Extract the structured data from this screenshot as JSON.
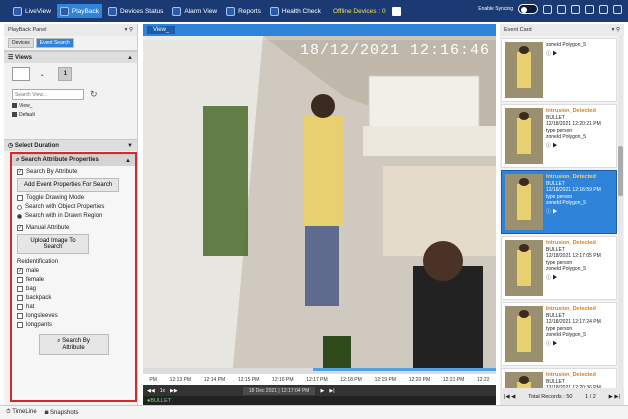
{
  "topbar": {
    "items": [
      {
        "label": "LiveView",
        "icon": "monitor-icon"
      },
      {
        "label": "PlayBack",
        "icon": "playback-icon"
      },
      {
        "label": "Devices Status",
        "icon": "devices-icon"
      },
      {
        "label": "Alarm View",
        "icon": "alarm-icon"
      },
      {
        "label": "Reports",
        "icon": "reports-icon"
      },
      {
        "label": "Health Check",
        "icon": "health-icon"
      }
    ],
    "offline": "Offline Devices : 0",
    "sync_label": "Enable Syncing"
  },
  "left_panel": {
    "title": "PlayBack Panel",
    "tabs": [
      "Devices",
      "Event Search"
    ],
    "views_title": "Views",
    "view_number": "1",
    "search_placeholder": "Search View...",
    "view_items": [
      "View_",
      "Default"
    ],
    "select_duration": "Select Duration",
    "attr_title": "Search Attribute Properties",
    "search_by_attribute": "Search By Attribute",
    "add_event_btn": "Add Event Properties For Search",
    "toggle_drawing": "Toggle Drawing Mode",
    "search_object": "Search with Object Properties",
    "search_drawn": "Search with in Drawn Region",
    "manual_attribute": "Manual Attribute",
    "upload_btn": "Upload Image To Search",
    "reid_label": "Reidentification",
    "reid_options": [
      {
        "label": "male",
        "checked": true
      },
      {
        "label": "female",
        "checked": false
      },
      {
        "label": "bag",
        "checked": false
      },
      {
        "label": "backpack",
        "checked": false
      },
      {
        "label": "hat",
        "checked": false
      },
      {
        "label": "longsleeves",
        "checked": false
      },
      {
        "label": "longpants",
        "checked": false
      }
    ],
    "search_btn": "Search By Attribute"
  },
  "video": {
    "tab": "View_",
    "timestamp": "18/12/2021 12:16:46",
    "ticks": [
      "PM",
      "12:13 PM",
      "12:14 PM",
      "12:15 PM",
      "12:16 PM",
      "12:17 PM",
      "12:18 PM",
      "12:19 PM",
      "12:20 PM",
      "12:21 PM",
      "12:22"
    ],
    "date": "18 Dec 2021 | 12:17:04 PM",
    "speed": "1x",
    "camera": "BULLET"
  },
  "right_panel": {
    "title": "Event Card",
    "cards": [
      {
        "title": "",
        "cam": "",
        "time": "",
        "type": "",
        "zone": "zoneId  Polygon_5",
        "selected": false
      },
      {
        "title": "Intrusion_Detected",
        "cam": "BULLET",
        "time": "12/18/2021 12:20:21 PM",
        "type": "type   person",
        "zone": "zoneId  Polygon_5",
        "selected": false
      },
      {
        "title": "Intrusion_Detected",
        "cam": "BULLET",
        "time": "12/18/2021 12:16:59 PM",
        "type": "type   person",
        "zone": "zoneId  Polygon_5",
        "selected": true
      },
      {
        "title": "Intrusion_Detected",
        "cam": "BULLET",
        "time": "12/18/2021 12:17:05 PM",
        "type": "type   person",
        "zone": "zoneId  Polygon_5",
        "selected": false
      },
      {
        "title": "Intrusion_Detected",
        "cam": "BULLET",
        "time": "12/18/2021 12:17:24 PM",
        "type": "type   person",
        "zone": "zoneId  Polygon_5",
        "selected": false
      },
      {
        "title": "Intrusion_Detected",
        "cam": "BULLET",
        "time": "12/18/2021 12:20:36 PM",
        "type": "type   person",
        "zone": "zoneId  Polygon_5",
        "selected": false
      }
    ],
    "total": "Total Records : 50",
    "page": "1 / 2"
  },
  "bottom": {
    "timeline": "TimeLine",
    "snapshots": "Snapshots"
  },
  "colors": {
    "topbar": "#1b3a74",
    "accent": "#2f83d9",
    "alert": "#e57a1a",
    "highlight": "#d42a2a"
  }
}
